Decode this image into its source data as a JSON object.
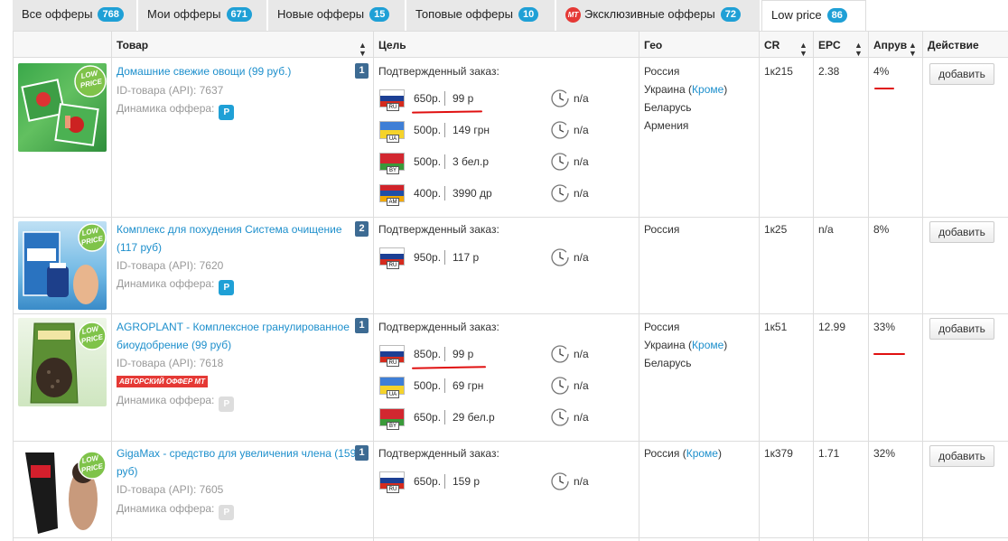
{
  "tabs": [
    {
      "label": "Все офферы",
      "count": "768"
    },
    {
      "label": "Мои офферы",
      "count": "671"
    },
    {
      "label": "Новые офферы",
      "count": "15"
    },
    {
      "label": "Топовые офферы",
      "count": "10"
    },
    {
      "label": "Эксклюзивные офферы",
      "count": "72",
      "badge": "MT"
    },
    {
      "label": "Low price",
      "count": "86",
      "active": true
    }
  ],
  "columns": {
    "product": "Товар",
    "goal": "Цель",
    "geo": "Гео",
    "cr": "CR",
    "epc": "EPC",
    "approve": "Апрув",
    "action": "Действие"
  },
  "labels": {
    "confirmed": "Подтвержденный заказ:",
    "dynamics": "Динамика оффера:",
    "p_badge": "P",
    "na": "n/a",
    "add": "добавить",
    "author_offer": "АВТОРСКИЙ ОФФЕР MT",
    "thumb_badge_line1": "LOW",
    "thumb_badge_line2": "PRICE"
  },
  "colors": {
    "link": "#1d8fcc",
    "badge": "#1fa0d6",
    "header_bg": "#f7f7f7",
    "underline": "#e01010"
  },
  "offers": [
    {
      "title_line1": "Домашние свежие овощи (99 руб.)",
      "title_line2": "",
      "num": "1",
      "id": "ID-товара (API): 7637",
      "dynamics_active": true,
      "author": false,
      "payouts": [
        {
          "country": "RU",
          "price": "650р.",
          "payout": "99 р"
        },
        {
          "country": "UA",
          "price": "500р.",
          "payout": "149 грн"
        },
        {
          "country": "BY",
          "price": "500р.",
          "payout": "3 бел.р"
        },
        {
          "country": "AM",
          "price": "400р.",
          "payout": "3990 др"
        }
      ],
      "geo": [
        {
          "name": "Россия"
        },
        {
          "name": "Украина",
          "extra": "Кроме"
        },
        {
          "name": "Беларусь"
        },
        {
          "name": "Армения"
        }
      ],
      "cr": "1к215",
      "epc": "2.38",
      "approve": "4%"
    },
    {
      "title_line1": "Комплекс для похудения Система очищение",
      "title_line2": "(117 руб)",
      "num": "2",
      "id": "ID-товара (API): 7620",
      "dynamics_active": true,
      "author": false,
      "payouts": [
        {
          "country": "RU",
          "price": "950р.",
          "payout": "117 р"
        }
      ],
      "geo": [
        {
          "name": "Россия"
        }
      ],
      "cr": "1к25",
      "epc": "n/a",
      "approve": "8%"
    },
    {
      "title_line1": "AGROPLANT - Комплексное гранулированное",
      "title_line2": "биоудобрение (99 руб)",
      "num": "1",
      "id": "ID-товара (API): 7618",
      "dynamics_active": false,
      "author": true,
      "payouts": [
        {
          "country": "RU",
          "price": "850р.",
          "payout": "99 р"
        },
        {
          "country": "UA",
          "price": "500р.",
          "payout": "69 грн"
        },
        {
          "country": "BY",
          "price": "650р.",
          "payout": "29 бел.р"
        }
      ],
      "geo": [
        {
          "name": "Россия"
        },
        {
          "name": "Украина",
          "extra": "Кроме"
        },
        {
          "name": "Беларусь"
        }
      ],
      "cr": "1к51",
      "epc": "12.99",
      "approve": "33%"
    },
    {
      "title_line1": "GigaMax - средство для увеличения члена (159",
      "title_line2": "руб)",
      "num": "1",
      "id": "ID-товара (API): 7605",
      "dynamics_active": false,
      "author": false,
      "payouts": [
        {
          "country": "RU",
          "price": "650р.",
          "payout": "159 р"
        }
      ],
      "geo": [
        {
          "name": "Россия",
          "extra": "Кроме"
        }
      ],
      "cr": "1к379",
      "epc": "1.71",
      "approve": "32%"
    }
  ]
}
